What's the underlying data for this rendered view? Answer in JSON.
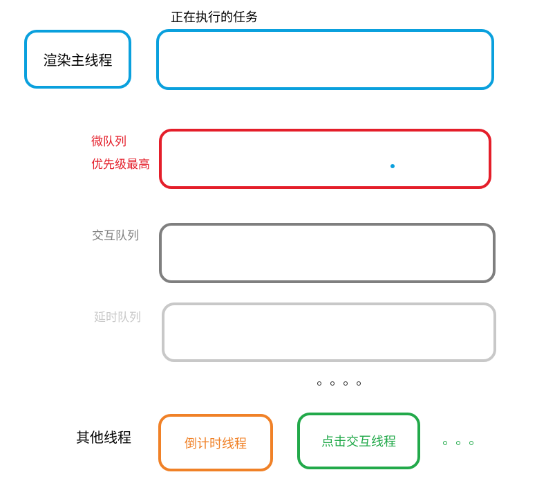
{
  "main_thread": {
    "label": "渲染主线程",
    "running_task_caption": "正在执行的任务",
    "color": "#0aa0dd"
  },
  "queues": [
    {
      "id": "micro",
      "name": "微队列",
      "note": "优先级最高",
      "color": "#e41e2a",
      "has_item_dot": true,
      "item_dot_color": "#0aa0dd"
    },
    {
      "id": "interaction",
      "name": "交互队列",
      "color": "#7f7f7f"
    },
    {
      "id": "delay",
      "name": "延时队列",
      "color": "#c8c8c8"
    }
  ],
  "ellipsis_queues": "。。。。",
  "other_threads": {
    "label": "其他线程",
    "threads": [
      {
        "name": "倒计时线程",
        "color": "#f08127"
      },
      {
        "name": "点击交互线程",
        "color": "#22a94a"
      }
    ],
    "ellipsis": "。。。",
    "ellipsis_color": "#22a94a"
  }
}
